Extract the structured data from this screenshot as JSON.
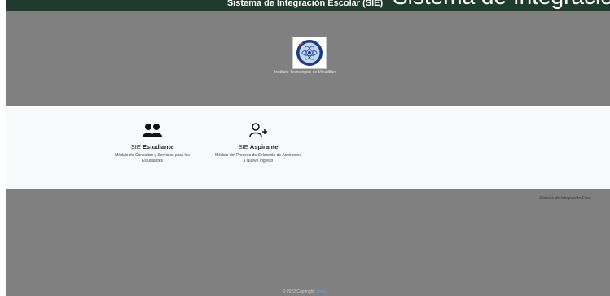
{
  "header": {
    "title": "Sistema de Integración Escolar (SIE)",
    "overflow_text": "Sistema de Integración Escolar"
  },
  "hero": {
    "institution": "Instituto Tecnológico de Minatitlán",
    "logo_icon": "institution-seal-icon"
  },
  "modules": [
    {
      "icon": "users-icon",
      "prefix": "SIE",
      "title": "Estudiante",
      "description": "Módulo de Consultas y Servicios para los Estudiantes"
    },
    {
      "icon": "user-plus-icon",
      "prefix": "SIE",
      "title": "Aspirante",
      "description": "Módulo del Proceso de Selección de Aspirantes a Nuevo Ingreso"
    }
  ],
  "footer": {
    "caption": "Sistema de Integración Esco",
    "copyright_text": "© 2022 Copyright:",
    "copyright_link": "Itmina"
  },
  "colors": {
    "header_dark": "#1f3a2e",
    "grey": "#808080",
    "band": "#f8f9fa",
    "link": "#4da3ff"
  }
}
